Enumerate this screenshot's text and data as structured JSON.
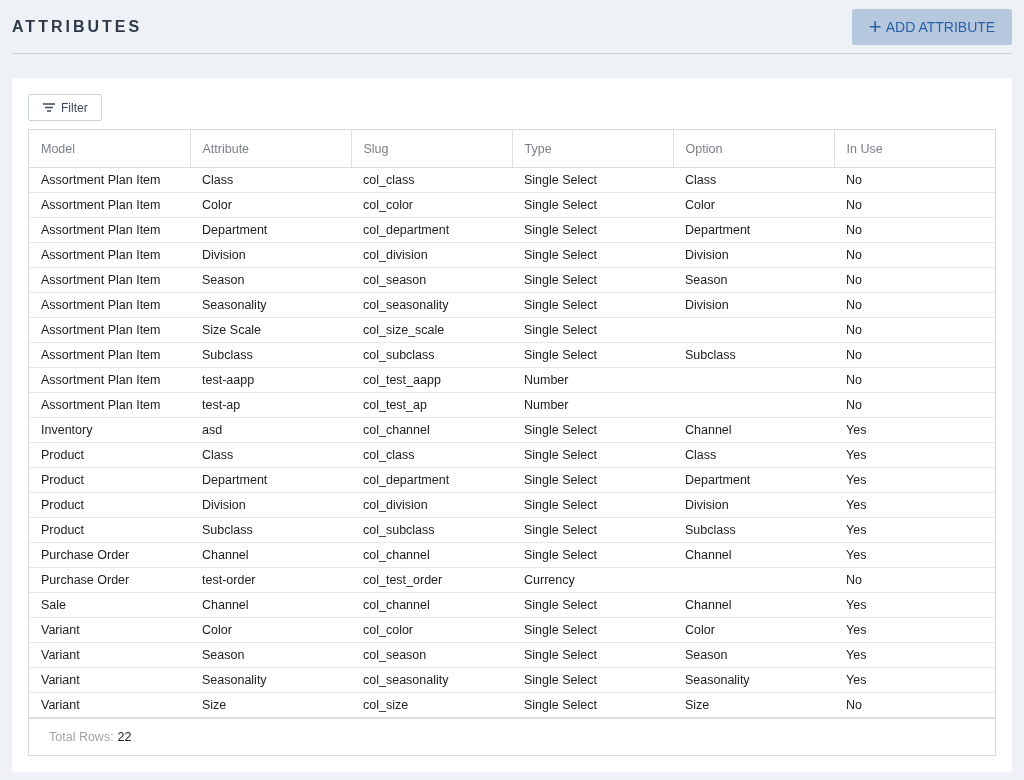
{
  "header": {
    "title": "ATTRIBUTES",
    "add_button": {
      "icon": "+",
      "label": "ADD ATTRIBUTE"
    }
  },
  "toolbar": {
    "filter_button": "Filter"
  },
  "table": {
    "columns": [
      "Model",
      "Attribute",
      "Slug",
      "Type",
      "Option",
      "In Use"
    ],
    "rows": [
      {
        "model": "Assortment Plan Item",
        "attribute": "Class",
        "slug": "col_class",
        "type": "Single Select",
        "option": "Class",
        "in_use": "No"
      },
      {
        "model": "Assortment Plan Item",
        "attribute": "Color",
        "slug": "col_color",
        "type": "Single Select",
        "option": "Color",
        "in_use": "No"
      },
      {
        "model": "Assortment Plan Item",
        "attribute": "Department",
        "slug": "col_department",
        "type": "Single Select",
        "option": "Department",
        "in_use": "No"
      },
      {
        "model": "Assortment Plan Item",
        "attribute": "Division",
        "slug": "col_division",
        "type": "Single Select",
        "option": "Division",
        "in_use": "No"
      },
      {
        "model": "Assortment Plan Item",
        "attribute": "Season",
        "slug": "col_season",
        "type": "Single Select",
        "option": "Season",
        "in_use": "No"
      },
      {
        "model": "Assortment Plan Item",
        "attribute": "Seasonality",
        "slug": "col_seasonality",
        "type": "Single Select",
        "option": "Division",
        "in_use": "No"
      },
      {
        "model": "Assortment Plan Item",
        "attribute": "Size Scale",
        "slug": "col_size_scale",
        "type": "Single Select",
        "in_use": "No"
      },
      {
        "model": "Assortment Plan Item",
        "attribute": "Subclass",
        "slug": "col_subclass",
        "type": "Single Select",
        "option": "Subclass",
        "in_use": "No"
      },
      {
        "model": "Assortment Plan Item",
        "attribute": "test-aapp",
        "slug": "col_test_aapp",
        "type": "Number",
        "in_use": "No"
      },
      {
        "model": "Assortment Plan Item",
        "attribute": "test-ap",
        "slug": "col_test_ap",
        "type": "Number",
        "in_use": "No"
      },
      {
        "model": "Inventory",
        "attribute": "asd",
        "slug": "col_channel",
        "type": "Single Select",
        "option": "Channel",
        "in_use": "Yes"
      },
      {
        "model": "Product",
        "attribute": "Class",
        "slug": "col_class",
        "type": "Single Select",
        "option": "Class",
        "in_use": "Yes"
      },
      {
        "model": "Product",
        "attribute": "Department",
        "slug": "col_department",
        "type": "Single Select",
        "option": "Department",
        "in_use": "Yes"
      },
      {
        "model": "Product",
        "attribute": "Division",
        "slug": "col_division",
        "type": "Single Select",
        "option": "Division",
        "in_use": "Yes"
      },
      {
        "model": "Product",
        "attribute": "Subclass",
        "slug": "col_subclass",
        "type": "Single Select",
        "option": "Subclass",
        "in_use": "Yes"
      },
      {
        "model": "Purchase Order",
        "attribute": "Channel",
        "slug": "col_channel",
        "type": "Single Select",
        "option": "Channel",
        "in_use": "Yes"
      },
      {
        "model": "Purchase Order",
        "attribute": "test-order",
        "slug": "col_test_order",
        "type": "Currency",
        "in_use": "No"
      },
      {
        "model": "Sale",
        "attribute": "Channel",
        "slug": "col_channel",
        "type": "Single Select",
        "option": "Channel",
        "in_use": "Yes"
      },
      {
        "model": "Variant",
        "attribute": "Color",
        "slug": "col_color",
        "type": "Single Select",
        "option": "Color",
        "in_use": "Yes"
      },
      {
        "model": "Variant",
        "attribute": "Season",
        "slug": "col_season",
        "type": "Single Select",
        "option": "Season",
        "in_use": "Yes"
      },
      {
        "model": "Variant",
        "attribute": "Seasonality",
        "slug": "col_seasonality",
        "type": "Single Select",
        "option": "Seasonality",
        "in_use": "Yes"
      },
      {
        "model": "Variant",
        "attribute": "Size",
        "slug": "col_size",
        "type": "Single Select",
        "option": "Size",
        "in_use": "No"
      }
    ]
  },
  "footer": {
    "label": "Total Rows:",
    "value": "22"
  }
}
